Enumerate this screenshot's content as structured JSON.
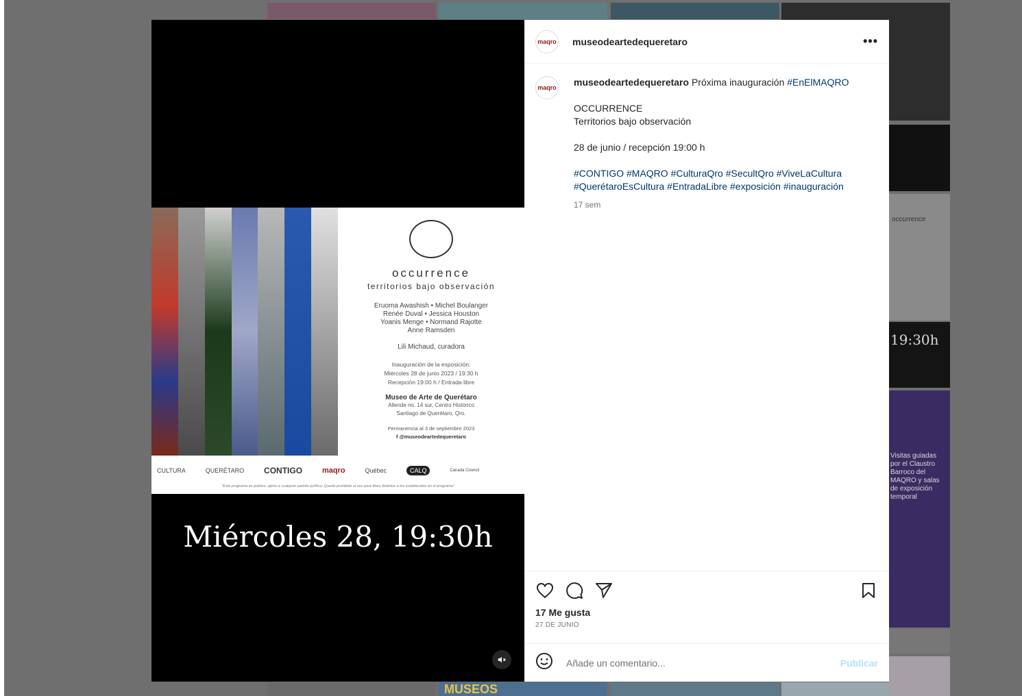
{
  "post": {
    "username": "museodeartedequeretaro",
    "avatar_text": "maqro",
    "more_label": "•••",
    "caption": {
      "user": "museodeartedequeretaro",
      "intro": "Próxima inauguración",
      "intro_tag": "#EnElMAQRO",
      "title": "OCCURRENCE",
      "subtitle": "Territorios bajo observación",
      "date_line": "28 de junio / recepción 19:00 h",
      "hashtags_line1": "#CONTIGO #MAQRO #CulturaQro #SecultQro #ViveLaCultura",
      "hashtags_line2": "#QuerétaroEsCultura #EntradaLibre #exposición #inauguración"
    },
    "time_ago": "17 sem",
    "likes": "17 Me gusta",
    "date": "27 DE JUNIO",
    "comment_placeholder": "Añade un comentario...",
    "publish_label": "Publicar"
  },
  "media": {
    "overlay_text": "Miércoles 28, 19:30h",
    "poster": {
      "title": "occurrence",
      "subtitle": "territorios bajo observación",
      "artists": [
        "Eruoma Awashish • Michel Boulanger",
        "Renée Duval • Jessica Houston",
        "Yoanis Menge • Normand Rajotte",
        "Anne Ramsden"
      ],
      "curator": "Lili Michaud, curadora",
      "inaug_label": "Inauguración de la exposición:",
      "inaug_date": "Miércoles 28 de junio 2023 / 19:30 h",
      "reception": "Recepción 19:00 h / Entrada libre",
      "museum": "Museo de Arte de Querétaro",
      "address1": "Allende no. 14 sur, Centro Histórico",
      "address2": "Santiago de Querétaro, Qro.",
      "permanence": "Permanencia al 3 de septiembre 2023",
      "social": "f @museodeartedequeretaro",
      "logos": [
        "CULTURA",
        "QUERÉTARO",
        "CONTIGO",
        "maqro",
        "Québec",
        "CALQ",
        "Canada Council",
        "",
        ""
      ],
      "disclaimer": "\"Este programa es público, ajeno a cualquier partido político. Queda prohibido el uso para fines distintos a los establecidos en el programa\""
    }
  },
  "background": {
    "fragments": [
      "19:30h",
      "occurrence",
      "Visitas guiadas por el Claustro Barroco del MAQRO y salas de exposición temporal",
      "MUSEOS"
    ]
  }
}
